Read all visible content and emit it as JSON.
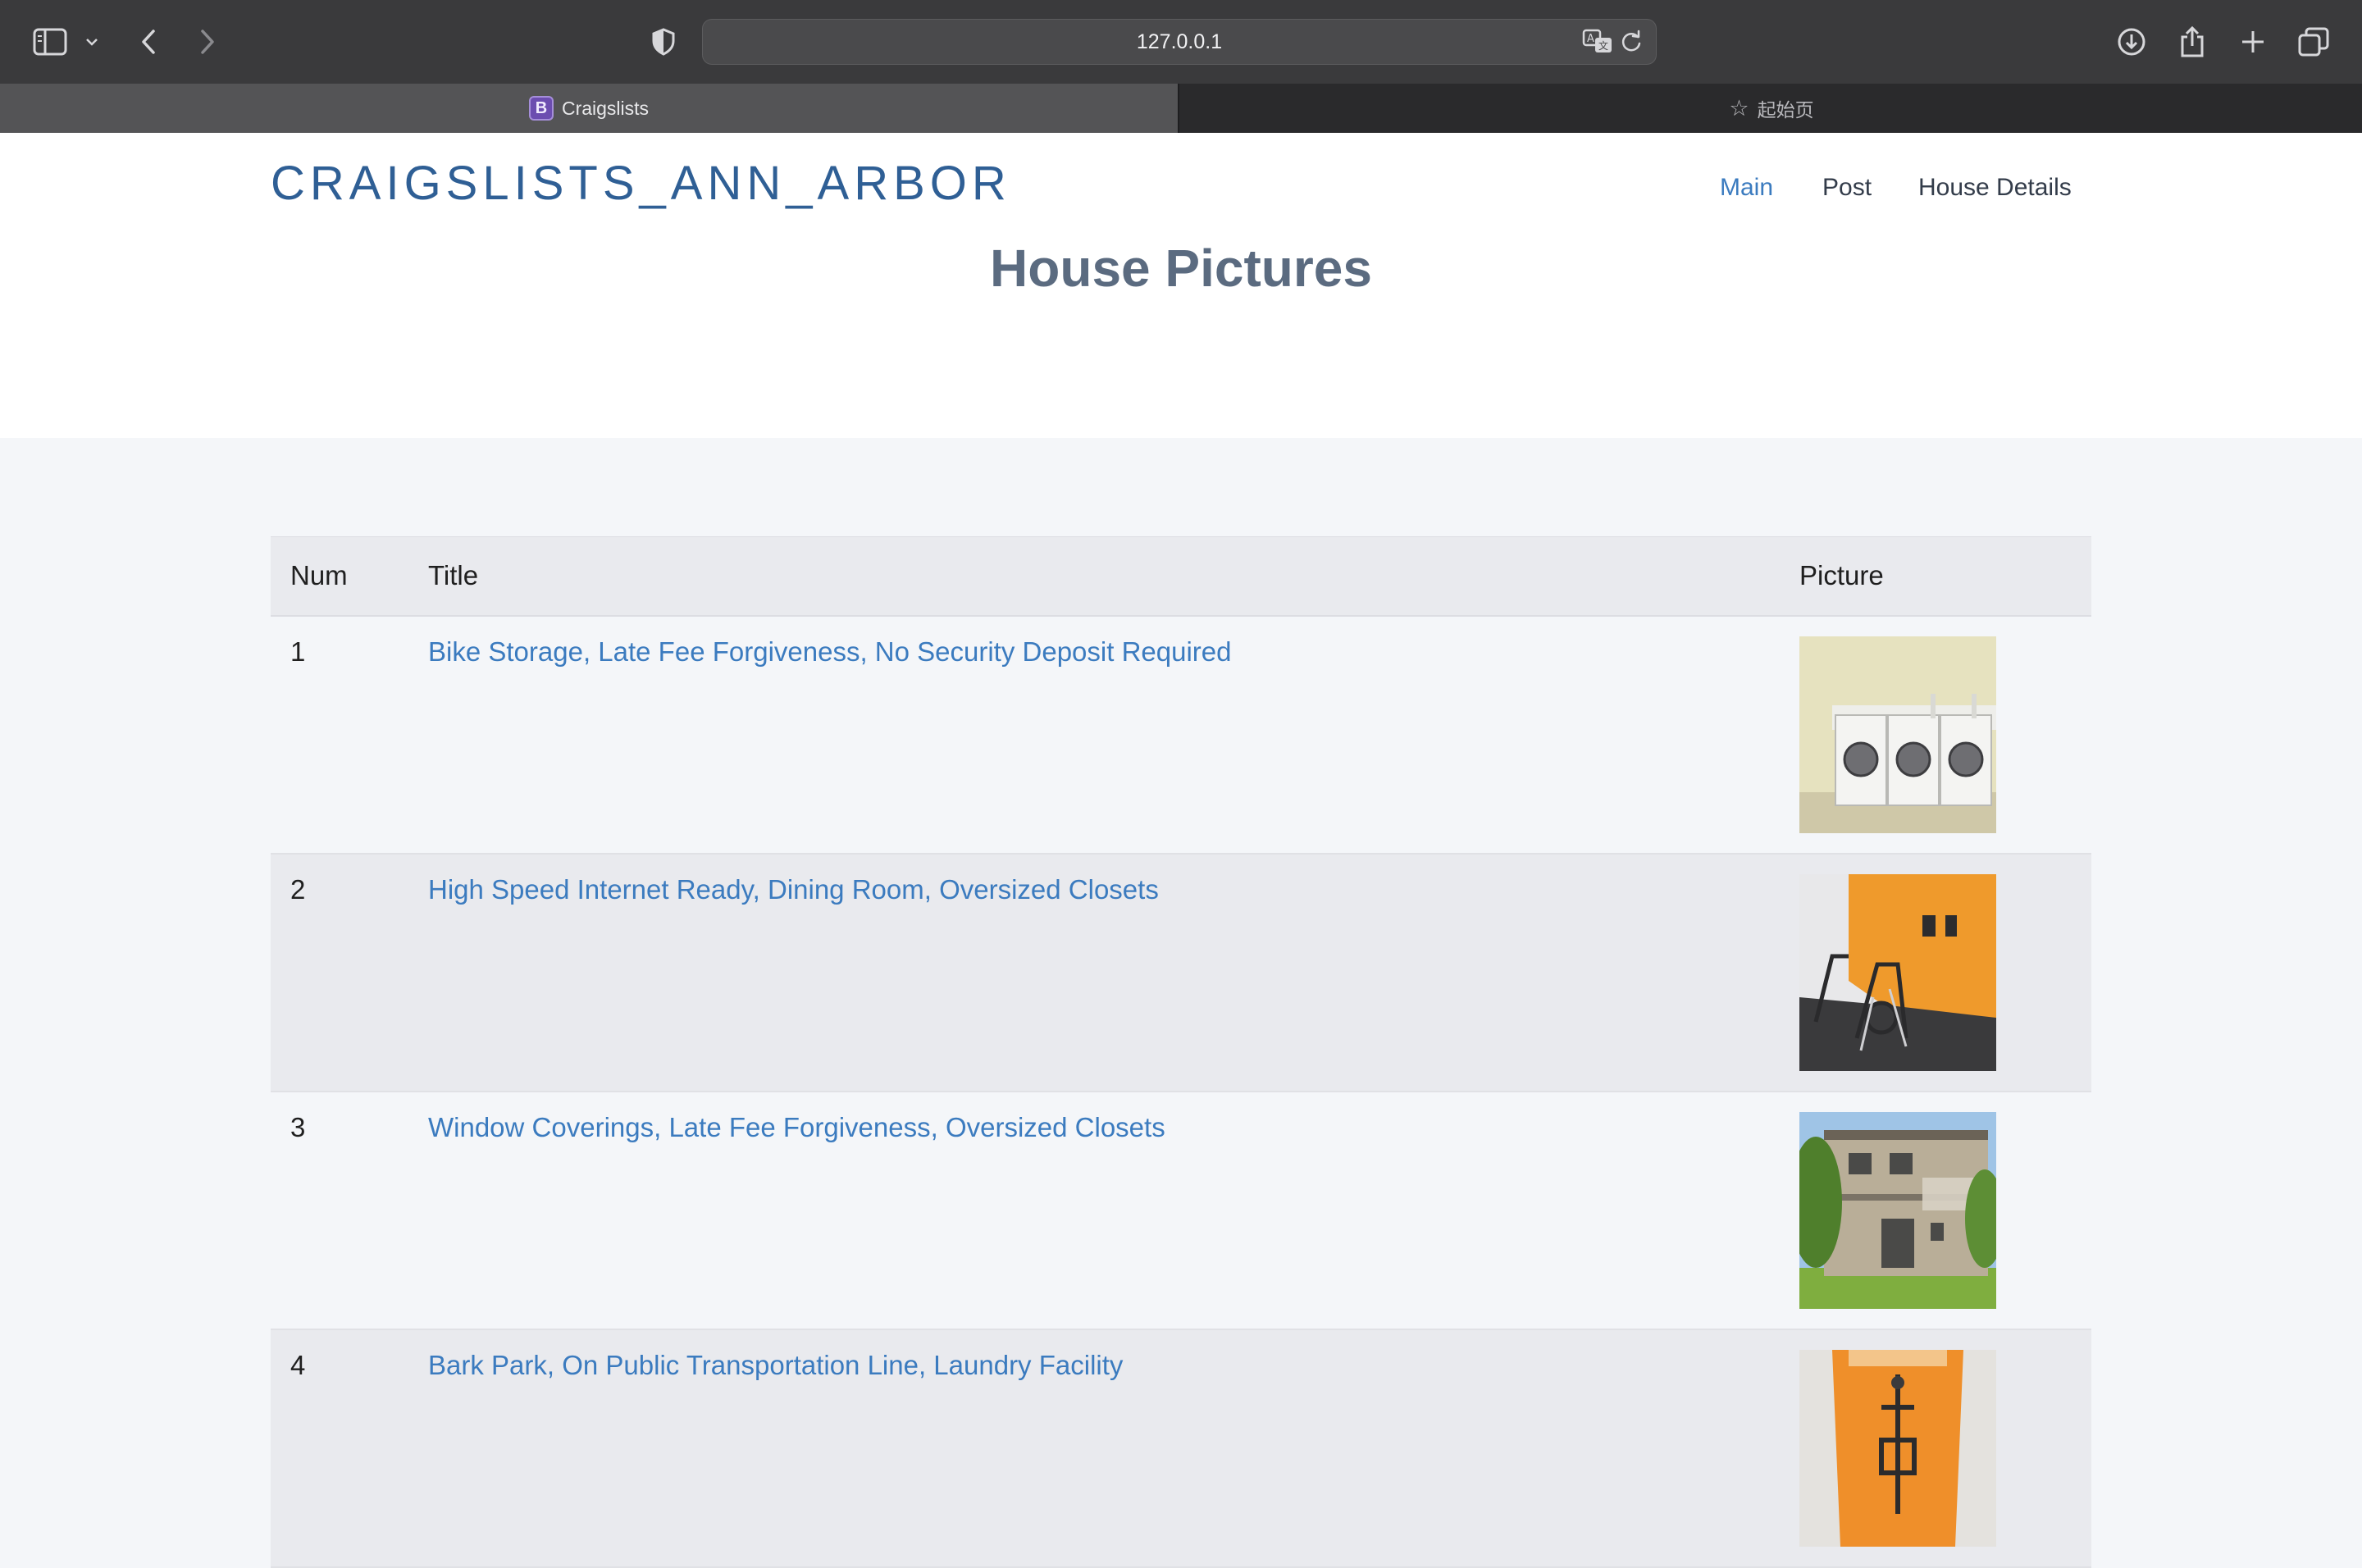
{
  "browser": {
    "url": "127.0.0.1",
    "tabs": [
      {
        "label": "Craigslists",
        "favicon_letter": "B",
        "active": true
      },
      {
        "label": "起始页",
        "active": false
      }
    ]
  },
  "site": {
    "brand": "CRAIGSLISTS_ANN_ARBOR",
    "nav": [
      "Main",
      "Post",
      "House Details"
    ],
    "page_title": "House Pictures"
  },
  "table": {
    "headers": [
      "Num",
      "Title",
      "Picture"
    ],
    "rows": [
      {
        "num": "1",
        "title": "Bike Storage, Late Fee Forgiveness, No Security Deposit Required",
        "picture": "laundry-room-photo"
      },
      {
        "num": "2",
        "title": "High Speed Internet Ready, Dining Room, Oversized Closets",
        "picture": "fitness-room-photo"
      },
      {
        "num": "3",
        "title": "Window Coverings, Late Fee Forgiveness, Oversized Closets",
        "picture": "building-exterior-photo"
      },
      {
        "num": "4",
        "title": "Bark Park, On Public Transportation Line, Laundry Facility",
        "picture": "gym-machine-photo"
      }
    ]
  },
  "colors": {
    "accent": "#3b7bbf",
    "brand": "#2f5f95",
    "title": "#5b6b80"
  }
}
